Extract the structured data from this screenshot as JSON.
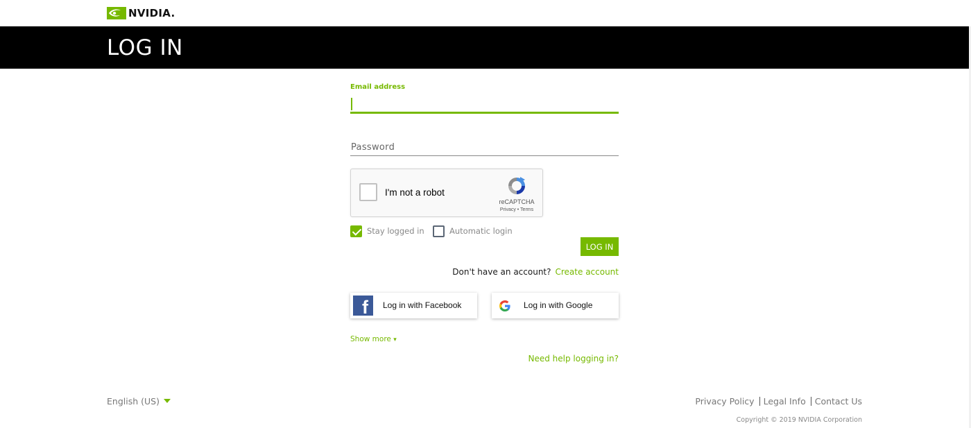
{
  "header": {
    "brand": "NVIDIA.",
    "page_title": "LOG IN"
  },
  "form": {
    "email_label": "Email address",
    "email_value": "",
    "password_placeholder": "Password",
    "captcha_text": "I'm not a robot",
    "captcha_brand": "reCAPTCHA",
    "captcha_links": "Privacy • Terms",
    "stay_logged_in_label": "Stay logged in",
    "stay_logged_in_checked": true,
    "auto_login_label": "Automatic login",
    "auto_login_checked": false,
    "login_button": "LOG IN",
    "no_account_text": "Don't have an account?",
    "create_account_link": "Create account",
    "facebook_button": "Log in with Facebook",
    "google_button": "Log in with Google",
    "show_more": "Show more",
    "help_link": "Need help logging in?"
  },
  "footer": {
    "language": "English (US)",
    "links": [
      "Privacy Policy",
      "Legal Info",
      "Contact Us"
    ],
    "copyright": "Copyright © 2019 NVIDIA Corporation"
  },
  "colors": {
    "accent": "#76b900",
    "banner": "#000000",
    "facebook": "#3b5998"
  },
  "icons": [
    "nvidia-logo-icon",
    "recaptcha-icon",
    "facebook-icon",
    "google-icon",
    "checkmark-icon",
    "chevron-down-icon"
  ]
}
